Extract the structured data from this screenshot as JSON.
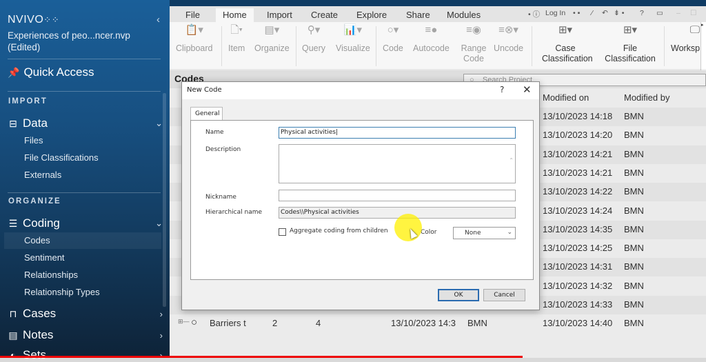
{
  "sidebar": {
    "logo": "NVIVO",
    "logo_icon": "dots-grid-icon",
    "collapse_icon": "chevron-left-icon",
    "project_name": "Experiences of peo...ncer.nvp",
    "project_status": "(Edited)",
    "quick_access": "Quick Access",
    "sections": [
      {
        "heading": "IMPORT"
      },
      {
        "heading": "ORGANIZE"
      }
    ],
    "data_group": {
      "label": "Data",
      "items": [
        "Files",
        "File Classifications",
        "Externals"
      ]
    },
    "coding_group": {
      "label": "Coding",
      "items": [
        "Codes",
        "Sentiment",
        "Relationships",
        "Relationship Types"
      ]
    },
    "cases": "Cases",
    "notes": "Notes",
    "sets": "Sets"
  },
  "ribbon": {
    "tabs": [
      "File",
      "Home",
      "Import",
      "Create",
      "Explore",
      "Share",
      "Modules"
    ],
    "active_tab": "Home",
    "quick_access_toolbar": {
      "login": "Log In",
      "help": "?"
    },
    "buttons": [
      {
        "label": "Clipboard",
        "icon": "clipboard-icon"
      },
      {
        "label": "Item",
        "icon": "document-icon"
      },
      {
        "label": "Organize",
        "icon": "organize-icon"
      },
      {
        "label": "Query",
        "icon": "search-icon"
      },
      {
        "label": "Visualize",
        "icon": "chart-icon"
      },
      {
        "label": "Code",
        "icon": "circle-icon"
      },
      {
        "label": "Autocode",
        "icon": "autocode-icon"
      },
      {
        "label": "Range Code",
        "icon": "range-code-icon"
      },
      {
        "label": "Uncode",
        "icon": "uncode-icon"
      },
      {
        "label": "Case Classification",
        "icon": "case-classification-icon"
      },
      {
        "label": "File Classification",
        "icon": "file-classification-icon"
      },
      {
        "label": "Worksp",
        "icon": "workspace-icon"
      }
    ]
  },
  "main": {
    "title": "Codes",
    "search_placeholder": "Search Project",
    "columns": {
      "modified_on": "Modified on",
      "modified_by": "Modified by"
    },
    "rows": [
      {
        "modified_on": "13/10/2023 14:18",
        "modified_by": "BMN"
      },
      {
        "modified_on": "13/10/2023 14:20",
        "modified_by": "BMN"
      },
      {
        "modified_on": "13/10/2023 14:21",
        "modified_by": "BMN"
      },
      {
        "modified_on": "13/10/2023 14:21",
        "modified_by": "BMN"
      },
      {
        "modified_on": "13/10/2023 14:22",
        "modified_by": "BMN"
      },
      {
        "modified_on": "13/10/2023 14:24",
        "modified_by": "BMN"
      },
      {
        "modified_on": "13/10/2023 14:35",
        "modified_by": "BMN"
      },
      {
        "modified_on": "13/10/2023 14:25",
        "modified_by": "BMN"
      },
      {
        "modified_on": "13/10/2023 14:31",
        "modified_by": "BMN"
      },
      {
        "modified_on": "13/10/2023 14:32",
        "modified_by": "BMN"
      },
      {
        "modified_on": "13/10/2023 14:33",
        "modified_by": "BMN"
      },
      {
        "name": "Barriers t",
        "files": "2",
        "references": "4",
        "created_on": "13/10/2023 14:3",
        "created_by": "BMN",
        "modified_on": "13/10/2023 14:40",
        "modified_by": "BMN"
      }
    ]
  },
  "dialog": {
    "title": "New Code",
    "help": "?",
    "close": "✕",
    "tab": "General",
    "name_label": "Name",
    "name_value": "Physical activities",
    "description_label": "Description",
    "description_value": "",
    "nickname_label": "Nickname",
    "nickname_value": "",
    "hierarchical_label": "Hierarchical name",
    "hierarchical_value": "Codes\\\\Physical activities",
    "aggregate_label": "Aggregate coding from children",
    "aggregate_checked": false,
    "color_label": "Color",
    "color_value": "None",
    "ok": "OK",
    "cancel": "Cancel"
  },
  "video_progress": 0.74
}
